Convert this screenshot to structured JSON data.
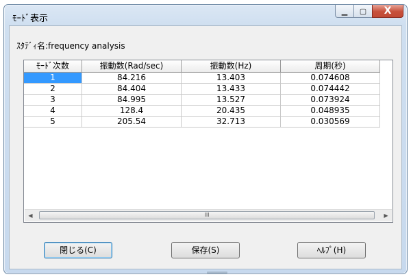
{
  "window": {
    "title": "ﾓｰﾄﾞ表示",
    "minimize_glyph": "▁",
    "maximize_glyph": "▢",
    "close_glyph": "X"
  },
  "study_label": "ｽﾀﾃﾞｨ名:frequency analysis",
  "table": {
    "headers": [
      "ﾓｰﾄﾞ次数",
      "振動数(Rad/sec)",
      "振動数(Hz)",
      "周期(秒)"
    ],
    "rows": [
      [
        "1",
        "84.216",
        "13.403",
        "0.074608"
      ],
      [
        "2",
        "84.404",
        "13.433",
        "0.074442"
      ],
      [
        "3",
        "84.995",
        "13.527",
        "0.073924"
      ],
      [
        "4",
        "128.4",
        "20.435",
        "0.048935"
      ],
      [
        "5",
        "205.54",
        "32.713",
        "0.030569"
      ]
    ]
  },
  "scrollbar": {
    "left_arrow": "◀",
    "right_arrow": "▶",
    "thumb_grip": "III"
  },
  "buttons": {
    "close": "閉じる(C)",
    "save": "保存(S)",
    "help": "ﾍﾙﾌﾟ(H)"
  },
  "colors": {
    "selection": "#3399ff",
    "close_button": "#c7503b"
  }
}
